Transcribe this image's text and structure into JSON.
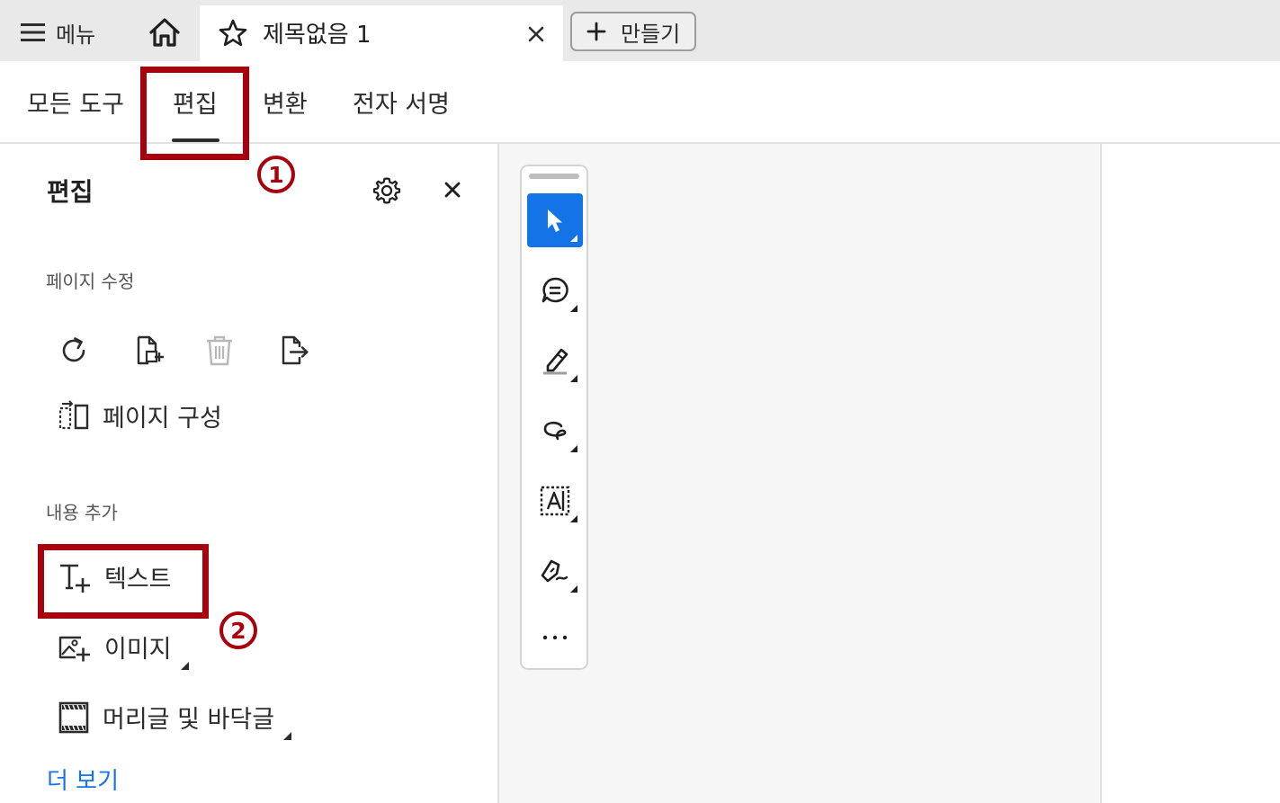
{
  "app": {
    "menu_label": "메뉴",
    "doc_tab_title": "제목없음 1",
    "create_label": "만들기"
  },
  "tool_tabs": {
    "all_tools": "모든 도구",
    "edit": "편집",
    "convert": "변환",
    "esign": "전자 서명"
  },
  "panel": {
    "title": "편집",
    "section_page": "페이지 수정",
    "page_organize": "페이지 구성",
    "section_add": "내용 추가",
    "text": "텍스트",
    "image": "이미지",
    "header_footer": "머리글 및 바닥글",
    "more": "더 보기"
  },
  "annotations": {
    "step1": "1",
    "step2": "2"
  },
  "icons": {
    "menu": "hamburger-icon",
    "home": "home-icon",
    "star": "star-icon",
    "close": "close-icon",
    "plus": "plus-icon",
    "settings": "gear-icon",
    "rotate": "rotate-icon",
    "insert": "insert-page-icon",
    "delete": "trash-icon",
    "extract": "extract-page-icon",
    "organize": "organize-pages-icon",
    "add_text": "add-text-icon",
    "add_image": "add-image-icon",
    "header_footer": "header-footer-icon",
    "select": "cursor-icon",
    "comment": "comment-icon",
    "highlight": "highlighter-icon",
    "draw": "freehand-draw-icon",
    "text_select": "text-box-icon",
    "sign": "sign-pen-icon",
    "more": "ellipsis-icon"
  },
  "colors": {
    "accent": "#1473e6",
    "annotation": "#a8000c",
    "disabled_icon": "#b8b8b8"
  }
}
